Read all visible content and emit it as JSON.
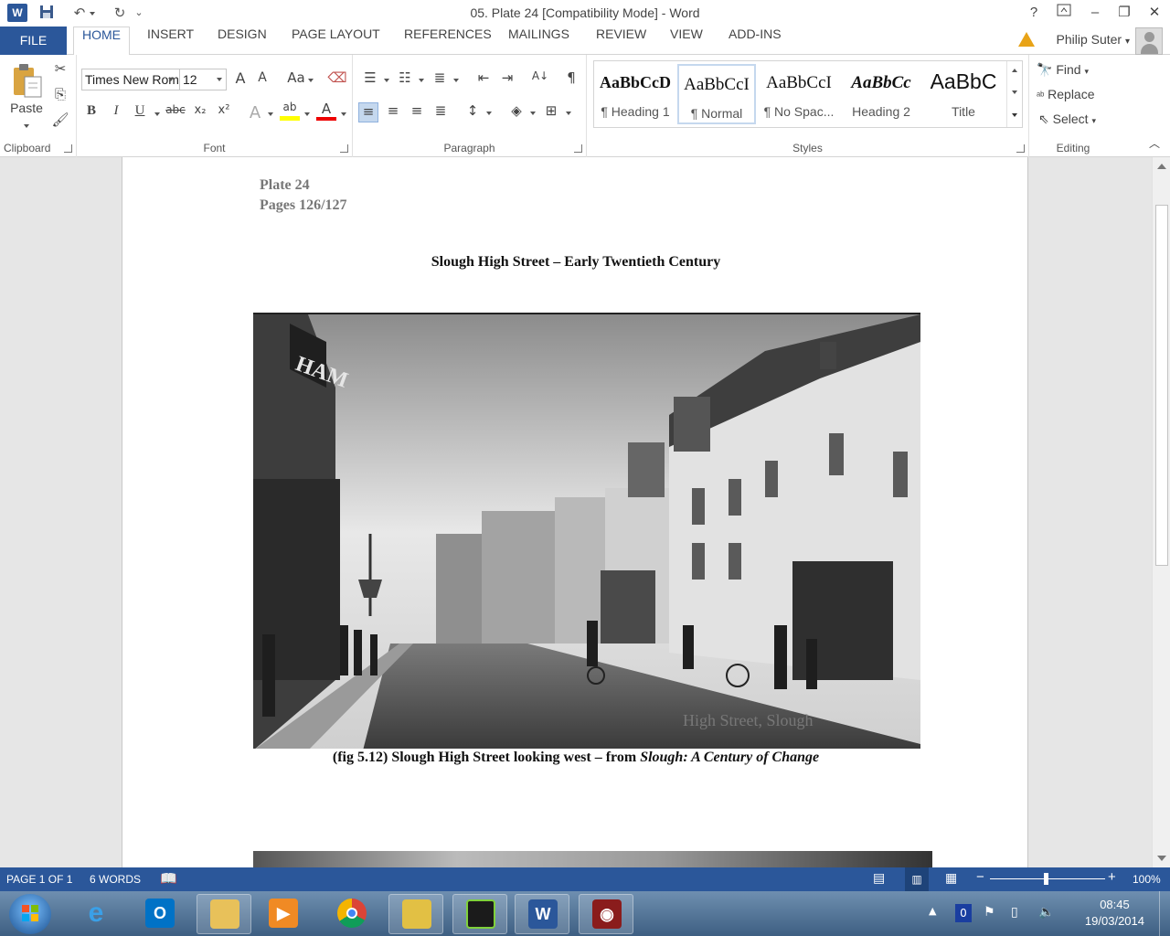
{
  "window": {
    "title": "05. Plate 24 [Compatibility Mode] - Word",
    "help": "?",
    "minimize": "–",
    "restore": "❐",
    "close": "✕",
    "ribbon_display": "⇧"
  },
  "qat": {
    "logo": "W",
    "save": "💾",
    "undo": "↶",
    "redo": "↻",
    "customize": "⌄"
  },
  "tabs": {
    "file": "FILE",
    "items": [
      "HOME",
      "INSERT",
      "DESIGN",
      "PAGE LAYOUT",
      "REFERENCES",
      "MAILINGS",
      "REVIEW",
      "VIEW",
      "ADD-INS"
    ],
    "user": "Philip Suter"
  },
  "ribbon": {
    "clipboard": {
      "label": "Clipboard",
      "paste": "Paste"
    },
    "font": {
      "label": "Font",
      "name": "Times New Rom",
      "size": "12",
      "grow": "A",
      "shrink": "A",
      "case": "Aa",
      "bold": "B",
      "italic": "I",
      "underline": "U",
      "strike": "abc",
      "subscript": "x₂",
      "superscript": "x²",
      "effects": "A",
      "highlight": "ab",
      "color": "A"
    },
    "paragraph": {
      "label": "Paragraph",
      "pilcrow": "¶",
      "sort": "A↓"
    },
    "styles": {
      "label": "Styles",
      "items": [
        {
          "sample": "AaBbCcD",
          "name": "¶ Heading 1"
        },
        {
          "sample": "AaBbCcI",
          "name": "¶ Normal"
        },
        {
          "sample": "AaBbCcI",
          "name": "¶ No Spac..."
        },
        {
          "sample": "AaBbCc",
          "name": "Heading 2"
        },
        {
          "sample": "AaBbC",
          "name": "Title"
        }
      ]
    },
    "editing": {
      "label": "Editing",
      "find": "Find",
      "replace": "Replace",
      "select": "Select"
    }
  },
  "document": {
    "plate": "Plate 24",
    "pages": "Pages 126/127",
    "heading": "Slough High Street – Early Twentieth Century",
    "photo_caption_in_image": "High Street, Slough",
    "photo_sign": "HAM",
    "caption_main": "(fig 5.12) Slough High Street looking west – from ",
    "caption_italic": "Slough: A Century of Change"
  },
  "statusbar": {
    "page": "PAGE 1 OF 1",
    "words": "6 WORDS",
    "zoom": "100%",
    "zoom_minus": "−",
    "zoom_plus": "+"
  },
  "taskbar": {
    "time": "08:45",
    "date": "19/03/2014",
    "notification_count": "0"
  },
  "colors": {
    "accent": "#2b579a",
    "taskbar": "#4a6b8e"
  }
}
